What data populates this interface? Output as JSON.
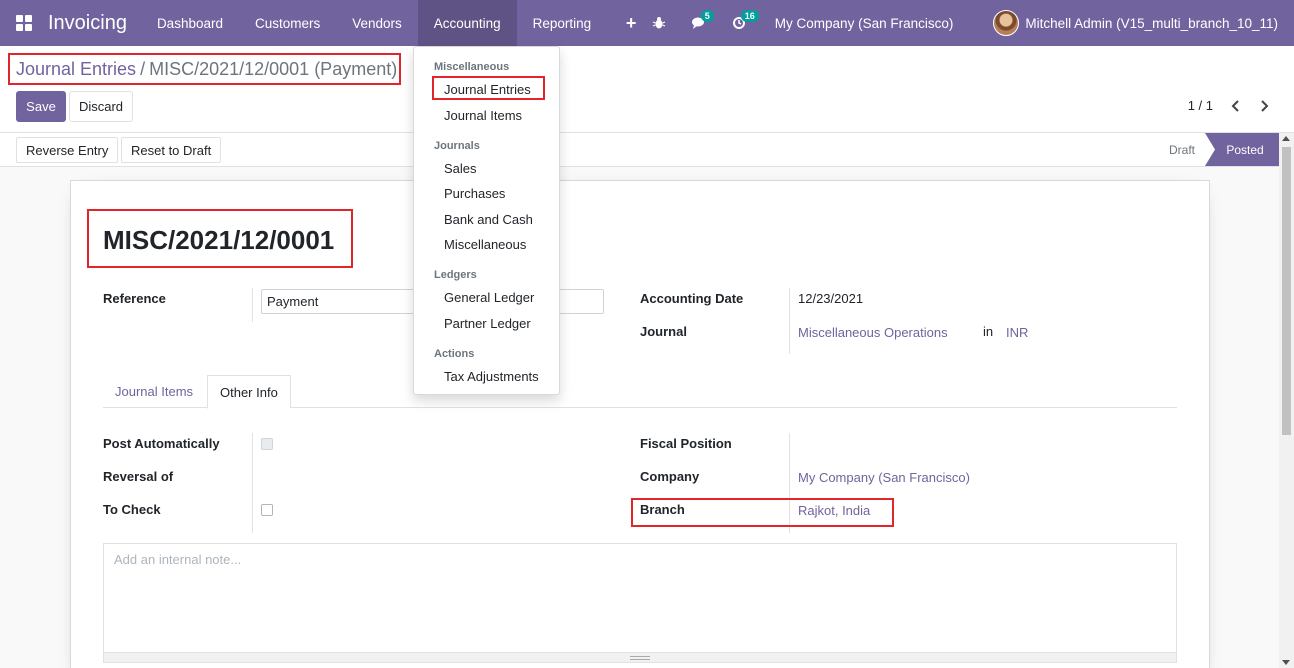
{
  "navbar": {
    "app_title": "Invoicing",
    "menu": [
      "Dashboard",
      "Customers",
      "Vendors",
      "Accounting",
      "Reporting"
    ],
    "active_menu": "Accounting",
    "messages_count": "5",
    "activities_count": "16",
    "company": "My Company (San Francisco)",
    "user": "Mitchell Admin (V15_multi_branch_10_11)"
  },
  "breadcrumb": {
    "parent": "Journal Entries",
    "separator": "/",
    "current": "MISC/2021/12/0001 (Payment)"
  },
  "buttons": {
    "save": "Save",
    "discard": "Discard"
  },
  "pager": {
    "value": "1 / 1"
  },
  "statusbar": {
    "reverse_entry": "Reverse Entry",
    "reset_to_draft": "Reset to Draft",
    "states": [
      "Draft",
      "Posted"
    ],
    "current_state": "Posted"
  },
  "record": {
    "name": "MISC/2021/12/0001",
    "reference_label": "Reference",
    "reference_value": "Payment",
    "accounting_date_label": "Accounting Date",
    "accounting_date_value": "12/23/2021",
    "journal_label": "Journal",
    "journal_value": "Miscellaneous Operations",
    "journal_in": "in",
    "journal_currency": "INR"
  },
  "tabs": [
    "Journal Items",
    "Other Info"
  ],
  "active_tab": "Other Info",
  "other_info": {
    "post_automatically_label": "Post Automatically",
    "reversal_of_label": "Reversal of",
    "to_check_label": "To Check",
    "fiscal_position_label": "Fiscal Position",
    "company_label": "Company",
    "company_value": "My Company (San Francisco)",
    "branch_label": "Branch",
    "branch_value": "Rajkot, India"
  },
  "note": {
    "placeholder": "Add an internal note..."
  },
  "dropdown": {
    "sections": [
      {
        "header": "Miscellaneous",
        "items": [
          "Journal Entries",
          "Journal Items"
        ]
      },
      {
        "header": "Journals",
        "items": [
          "Sales",
          "Purchases",
          "Bank and Cash",
          "Miscellaneous"
        ]
      },
      {
        "header": "Ledgers",
        "items": [
          "General Ledger",
          "Partner Ledger"
        ]
      },
      {
        "header": "Actions",
        "items": [
          "Tax Adjustments"
        ]
      }
    ]
  },
  "colors": {
    "brand": "#71639e",
    "highlight": "#e0262d"
  }
}
